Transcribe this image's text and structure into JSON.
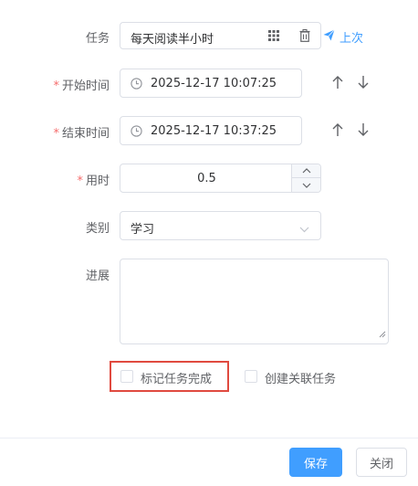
{
  "form": {
    "task": {
      "label": "任务",
      "value": "每天阅读半小时",
      "last_label": "上次"
    },
    "start_time": {
      "required_mark": "*",
      "label": "开始时间",
      "value": "2025-12-17 10:07:25"
    },
    "end_time": {
      "required_mark": "*",
      "label": "结束时间",
      "value": "2025-12-17 10:37:25"
    },
    "duration": {
      "required_mark": "*",
      "label": "用时",
      "value": "0.5"
    },
    "category": {
      "label": "类别",
      "value": "学习"
    },
    "progress": {
      "label": "进展",
      "value": ""
    },
    "mark_complete": {
      "label": "标记任务完成",
      "checked": false
    },
    "create_related": {
      "label": "创建关联任务",
      "checked": false
    }
  },
  "footer": {
    "save_label": "保存",
    "close_label": "关闭"
  },
  "colors": {
    "primary": "#409eff",
    "required": "#f56c6c",
    "highlight": "#e04a3f",
    "border": "#dcdfe6"
  }
}
